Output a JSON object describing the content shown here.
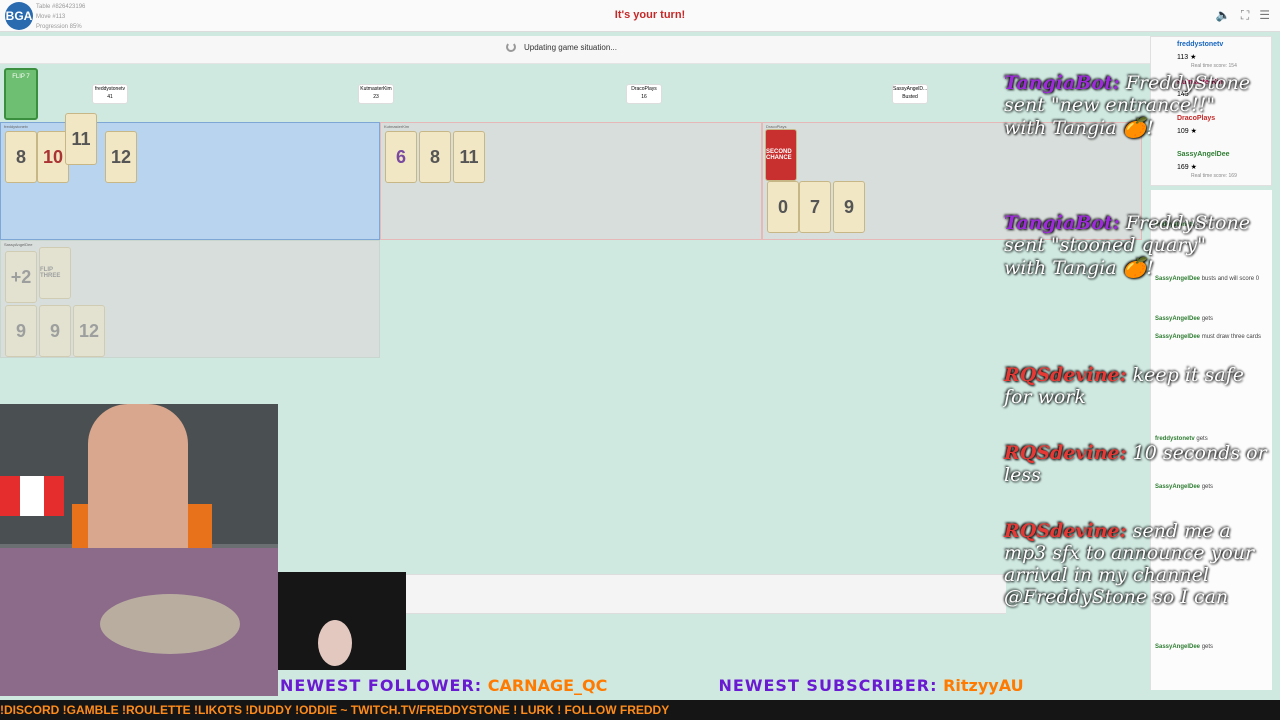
{
  "top": {
    "table_line1": "Table #826423196",
    "table_line2": "Move #113",
    "table_line3": "Progression 85%",
    "turn_text": "It's your turn!"
  },
  "status": {
    "updating": "Updating game situation..."
  },
  "flip_card": "FLIP 7",
  "tags": [
    {
      "name": "freddystonetv",
      "score": "41"
    },
    {
      "name": "KutmasterKim",
      "score": "23"
    },
    {
      "name": "DracoPlays",
      "score": "16"
    },
    {
      "name": "SassyAngelD...",
      "score": "Busted"
    }
  ],
  "zones": [
    {
      "label": "freddystonetv",
      "cards": [
        "8",
        "10",
        "11",
        "12"
      ]
    },
    {
      "label": "KutmasterKim",
      "cards": [
        "6",
        "8",
        "11"
      ]
    },
    {
      "label": "DracoPlays",
      "cards": [
        "SECOND CHANCE",
        "0",
        "7",
        "9"
      ]
    },
    {
      "label": "SassyAngelDee",
      "cards": [
        "+2",
        "FLIP THREE",
        "9",
        "9",
        "12"
      ]
    }
  ],
  "chat": [
    {
      "name": "TangiaBot:",
      "text": "FreddyStone sent \"new entrance!!\" with Tangia 🍊!"
    },
    {
      "name": "TangiaBot:",
      "text": "FreddyStone sent \"stooned quary\" with Tangia 🍊!"
    },
    {
      "name": "RQSdevine:",
      "text": "keep it safe for work"
    },
    {
      "name": "RQSdevine:",
      "text": "10 seconds or less"
    },
    {
      "name": "RQSdevine:",
      "text": "send me a mp3 sfx to announce your arrival in my channel @FreddyStone so I can"
    }
  ],
  "players": [
    {
      "name": "freddystonetv",
      "score": "113 ★",
      "time": "Real time score: 154",
      "color": "#1565c0"
    },
    {
      "name": "KutmasterKim",
      "score": "145",
      "time": "",
      "color": "#c2185b"
    },
    {
      "name": "DracoPlays",
      "score": "109 ★",
      "time": "",
      "color": "#c62828"
    },
    {
      "name": "SassyAngelDee",
      "score": "169 ★",
      "time": "Real time score: 169",
      "color": "#2e7d32"
    }
  ],
  "log": [
    {
      "name": "freddystonetv",
      "text": "gets"
    },
    {
      "name": "SassyAngelDee",
      "text": "busts and will score 0"
    },
    {
      "name": "SassyAngelDee",
      "text": "gets"
    },
    {
      "name": "SassyAngelDee",
      "text": "must draw three cards"
    },
    {
      "name": "freddystonetv",
      "text": "gets"
    },
    {
      "name": "SassyAngelDee",
      "text": "gets"
    },
    {
      "name": "SassyAngelDee",
      "text": "gets"
    }
  ],
  "banner": {
    "follower_label": "NEWEST FOLLOWER:",
    "follower": "CARNAGE_QC",
    "sub_label": "NEWEST SUBSCRIBER:",
    "sub": "RitzyyAU"
  },
  "ticker": "!DISCORD !GAMBLE !ROULETTE !LIKOTS !DUDDY !ODDIE ~ TWITCH.TV/FREDDYSTONE ! LURK ! FOLLOW FREDDY"
}
